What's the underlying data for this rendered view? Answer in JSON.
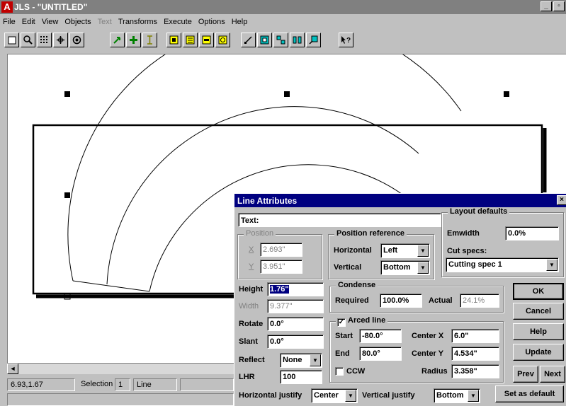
{
  "window": {
    "title": "JLS - \"UNTITLED\"",
    "app_icon": "A",
    "minimize": "_",
    "restore": "▫"
  },
  "menu": [
    {
      "key": "file",
      "label": "File",
      "mnemonic": "F",
      "rest": "ile",
      "disabled": false
    },
    {
      "key": "edit",
      "label": "Edit",
      "mnemonic": "E",
      "rest": "dit",
      "disabled": false
    },
    {
      "key": "view",
      "label": "View",
      "mnemonic": "V",
      "rest": "iew",
      "disabled": false
    },
    {
      "key": "objects",
      "label": "Objects",
      "mnemonic": "O",
      "rest": "bjects",
      "disabled": false
    },
    {
      "key": "text",
      "label": "Text",
      "mnemonic": "T",
      "rest": "ext",
      "disabled": true
    },
    {
      "key": "transforms",
      "label": "Transforms",
      "mnemonic": "T",
      "rest": "ransforms",
      "disabled": false
    },
    {
      "key": "execute",
      "label": "Execute",
      "mnemonic": "x",
      "rest": "",
      "disabled": false
    },
    {
      "key": "options",
      "label": "Options",
      "mnemonic": "O",
      "rest": "ptions",
      "disabled": false
    },
    {
      "key": "help",
      "label": "Help",
      "mnemonic": "H",
      "rest": "elp",
      "disabled": false
    }
  ],
  "toolbar_icons": [
    "new-page-icon",
    "zoom-icon",
    "grid-icon",
    "move-icon",
    "view-icon",
    "pointer-icon",
    "add-node-icon",
    "text-cursor-icon",
    "layer-1-icon",
    "layer-2-icon",
    "layer-3-icon",
    "layer-4-icon",
    "line-tool-icon",
    "box-select-icon",
    "align-icon",
    "distribute-icon",
    "transform-icon",
    "context-help-icon"
  ],
  "status": {
    "coords": "6.93,1.67",
    "selection_label": "Selection",
    "selection_value": "1",
    "object_type": "Line"
  },
  "dialog": {
    "title": "Line Attributes",
    "close": "×",
    "text_label": "Text:",
    "text_value": "",
    "position": {
      "title": "Position",
      "x_label": "X",
      "x_value": "2.693\"",
      "y_label": "Y",
      "y_value": "3.951\""
    },
    "position_reference": {
      "title": "Position reference",
      "horizontal_label": "Horizontal",
      "horizontal_value": "Left",
      "vertical_label": "Vertical",
      "vertical_value": "Bottom"
    },
    "layout_defaults": {
      "title": "Layout defaults",
      "emwidth_label": "Emwidth",
      "emwidth_value": "0.0%",
      "cutspecs_label": "Cut specs:",
      "cutspecs_value": "Cutting spec 1"
    },
    "height_label": "Height",
    "height_value": "1.76\"",
    "width_label": "Width",
    "width_value": "9.377\"",
    "rotate_label": "Rotate",
    "rotate_value": "0.0°",
    "slant_label": "Slant",
    "slant_value": "0.0°",
    "reflect_label": "Reflect",
    "reflect_value": "None",
    "lhr_label": "LHR",
    "lhr_value": "100",
    "condense": {
      "title": "Condense",
      "required_label": "Required",
      "required_value": "100.0%",
      "actual_label": "Actual",
      "actual_value": "24.1%"
    },
    "arced": {
      "title": "Arced line",
      "checked": "✓",
      "start_label": "Start",
      "start_value": "-80.0°",
      "end_label": "End",
      "end_value": "80.0°",
      "ccw_label": "CCW",
      "center_x_label": "Center X",
      "center_x_value": "6.0\"",
      "center_y_label": "Center Y",
      "center_y_value": "4.534\"",
      "radius_label": "Radius",
      "radius_value": "3.358\""
    },
    "buttons": {
      "ok": "OK",
      "cancel": "Cancel",
      "help": "Help",
      "update": "Update",
      "prev": "Prev",
      "next": "Next",
      "set_default": "Set as default"
    },
    "hjustify_label": "Horizontal justify",
    "hjustify_value": "Center",
    "vjustify_label": "Vertical justify",
    "vjustify_value": "Bottom"
  }
}
